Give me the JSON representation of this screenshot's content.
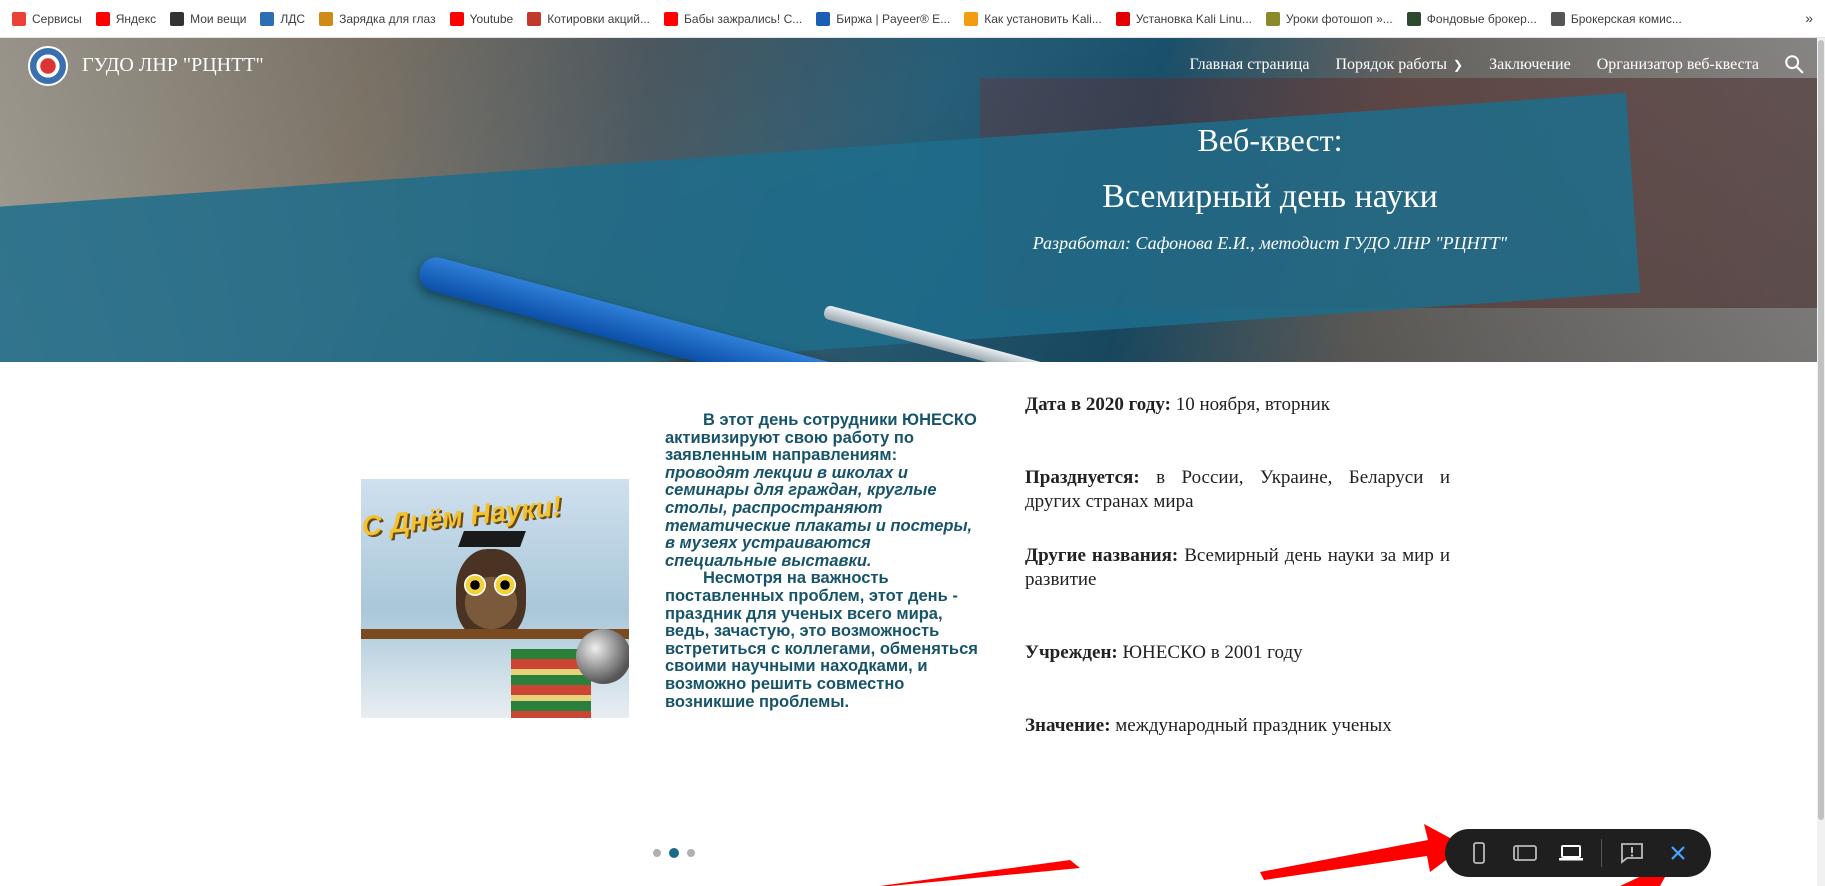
{
  "bookmarks": {
    "items": [
      {
        "label": "Сервисы",
        "icon": "apps-grid-icon",
        "color": "#ea4335"
      },
      {
        "label": "Яндекс",
        "icon": "yandex-icon",
        "color": "#ff0000"
      },
      {
        "label": "Мои вещи",
        "icon": "globe-icon",
        "color": "#333333"
      },
      {
        "label": "ЛДС",
        "icon": "ldc-icon",
        "color": "#2c6db5"
      },
      {
        "label": "Зарядка для глаз",
        "icon": "eye-charge-icon",
        "color": "#d08a1a"
      },
      {
        "label": "Youtube",
        "icon": "youtube-icon",
        "color": "#ff0000"
      },
      {
        "label": "Котировки акций...",
        "icon": "quotes-icon",
        "color": "#c0392b"
      },
      {
        "label": "Бабы зажрались! С...",
        "icon": "youtube-icon",
        "color": "#ff0000"
      },
      {
        "label": "Биржа | Payeer® E...",
        "icon": "payeer-icon",
        "color": "#1a5fb4"
      },
      {
        "label": "Как установить Kali...",
        "icon": "kali-icon",
        "color": "#f39c12"
      },
      {
        "label": "Установка Kali Linu...",
        "icon": "checkmark-icon",
        "color": "#e00000"
      },
      {
        "label": "Уроки фотошоп »...",
        "icon": "photoshop-icon",
        "color": "#8a8a2a"
      },
      {
        "label": "Фондовые брокер...",
        "icon": "broker-icon",
        "color": "#2d4a2d"
      },
      {
        "label": "Брокерская комис...",
        "icon": "globe-icon",
        "color": "#555555"
      }
    ],
    "more": "»"
  },
  "header": {
    "site_title": "ГУДО ЛНР \"РЦНТТ\"",
    "nav": [
      {
        "label": "Главная страница"
      },
      {
        "label": "Порядок работы",
        "dropdown": true
      },
      {
        "label": "Заключение"
      },
      {
        "label": "Организатор веб-квеста"
      }
    ]
  },
  "hero": {
    "line1": "Веб-квест:",
    "line2": "Всемирный день науки",
    "line3": "Разработал: Сафонова Е.И., методист ГУДО ЛНР \"РЦНТТ\""
  },
  "image": {
    "caption": "С Днём Науки!"
  },
  "text_block": {
    "p1_start": "В этот день сотрудники ЮНЕСКО активизируют свою работу по заявленным направлениям: ",
    "p1_italic": "проводят лекции в школах и семинары для граждан, круглые столы, распространяют тематические плакаты и постеры, в музеях устраиваются специальные выставки.",
    "p2": "Несмотря на важность поставленных проблем, этот день - праздник для ученых всего мира, ведь, зачастую, это возможность встретиться с коллегами, обменяться своими научными находками, и возможно решить совместно возникшие проблемы."
  },
  "facts": [
    {
      "label": "Дата в 2020 году:",
      "value": " 10 ноября, вторник"
    },
    {
      "label": "Празднуется:",
      "value": " в России, Украине, Беларуси и других странах мира"
    },
    {
      "label": "Другие названия:",
      "value": " Всемирный день науки за мир и развитие"
    },
    {
      "label": "Учрежден:",
      "value": " ЮНЕСКО в 2001 году"
    },
    {
      "label": "Значение:",
      "value": " международный праздник ученых"
    }
  ],
  "carousel": {
    "count": 3,
    "active": 1
  },
  "colors": {
    "text_teal": "#17546a",
    "dot_active": "#1c6a8a",
    "preview_bar": "#1f1f1f",
    "close_blue": "#4da3ff",
    "arrow_red": "#ff0000"
  }
}
